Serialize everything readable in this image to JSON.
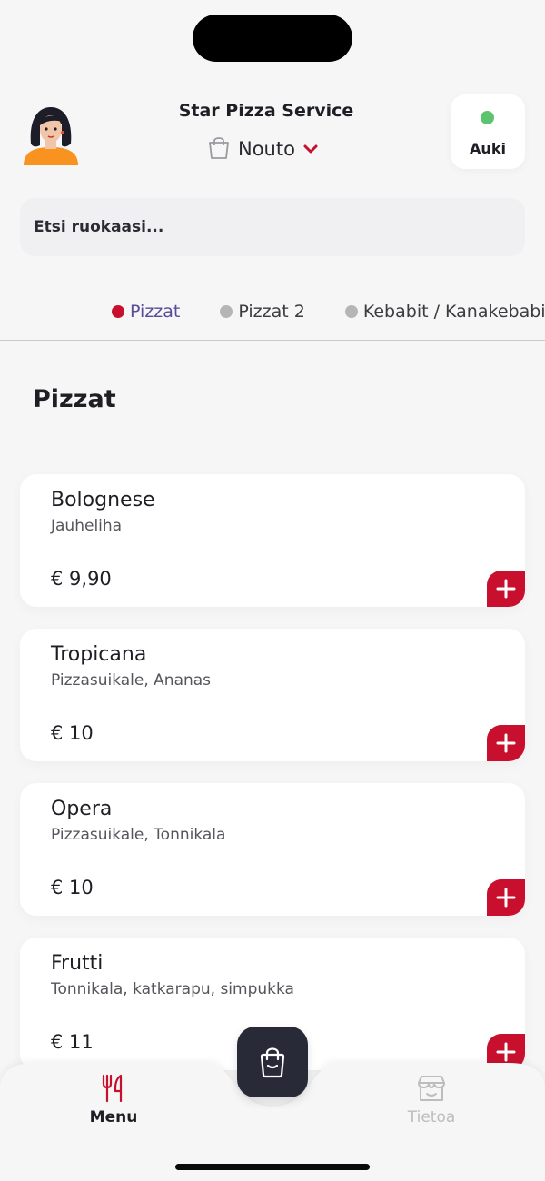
{
  "header": {
    "store_name": "Star Pizza Service",
    "order_mode": "Nouto",
    "status_label": "Auki",
    "status_color": "#5cc46e",
    "accent_color": "#c8102e"
  },
  "search": {
    "placeholder": "Etsi ruokaasi..."
  },
  "categories": [
    {
      "label": "Pizzat",
      "active": true
    },
    {
      "label": "Pizzat 2",
      "active": false
    },
    {
      "label": "Kebabit / Kanakebabit",
      "active": false
    }
  ],
  "section": {
    "title": "Pizzat"
  },
  "items": [
    {
      "name": "Bolognese",
      "description": "Jauheliha",
      "price": "€ 9,90"
    },
    {
      "name": "Tropicana",
      "description": "Pizzasuikale, Ananas",
      "price": "€ 10"
    },
    {
      "name": "Opera",
      "description": "Pizzasuikale, Tonnikala",
      "price": "€ 10"
    },
    {
      "name": "Frutti",
      "description": "Tonnikala, katkarapu, simpukka",
      "price": "€ 11"
    }
  ],
  "nav": {
    "menu_label": "Menu",
    "info_label": "Tietoa"
  },
  "icons": {
    "avatar": "avatar-icon",
    "bag": "shopping-bag-icon",
    "chevron": "chevron-down-icon",
    "plus": "plus-icon",
    "fork_knife": "fork-knife-icon",
    "store": "store-icon"
  }
}
